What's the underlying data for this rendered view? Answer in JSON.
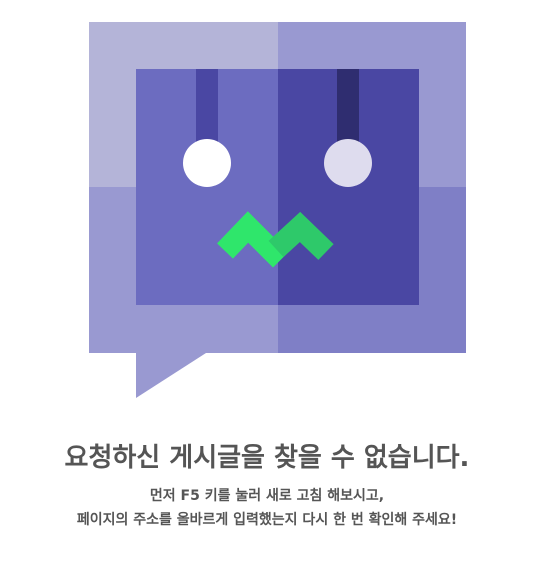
{
  "error": {
    "headline": "요청하신 게시글을 찾을 수 없습니다.",
    "desc_line1": "먼저 F5 키를 눌러 새로 고침 해보시고,",
    "desc_line2": "페이지의 주소를 올바르게 입력했는지 다시 한 번 확인해 주세요!"
  },
  "illustration": {
    "icon": "sad-robot-speech-bubble-icon",
    "colors": {
      "bubble_light": "#b4b4d8",
      "bubble_mid": "#9999d1",
      "bubble_dark": "#7f7fc6",
      "face_left": "#6c6cc0",
      "face_right": "#4a47a3",
      "antenna_left": "#4a47a3",
      "antenna_right": "#2f2d70",
      "eye_left": "#ffffff",
      "eye_right": "#dedcee",
      "mouth_left": "#2fe66b",
      "mouth_right": "#2ec96a"
    }
  }
}
